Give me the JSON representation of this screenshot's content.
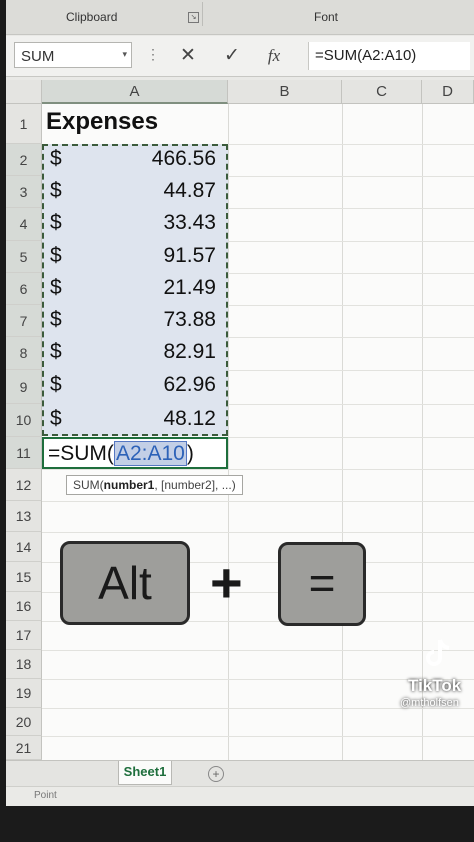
{
  "ribbon": {
    "clipboard_label": "Clipboard",
    "font_label": "Font"
  },
  "formula_bar": {
    "name_box": "SUM",
    "name_box_arrow": "▾",
    "dots": "⋮",
    "cancel_symbol": "✕",
    "enter_symbol": "✓",
    "fx_symbol": "fx",
    "formula": "=SUM(A2:A10)"
  },
  "columns": [
    "A",
    "B",
    "C",
    "D"
  ],
  "rows": [
    "1",
    "2",
    "3",
    "4",
    "5",
    "6",
    "7",
    "8",
    "9",
    "10",
    "11",
    "12",
    "13",
    "14",
    "15",
    "16",
    "17",
    "18",
    "19",
    "20",
    "21"
  ],
  "sheet": {
    "header": "Expenses",
    "currency_symbol": "$",
    "values": [
      "466.56",
      "44.87",
      "33.43",
      "91.57",
      "21.49",
      "73.88",
      "82.91",
      "62.96",
      "48.12"
    ],
    "active_cell": {
      "prefix": "=SUM(",
      "ref": "A2:A10",
      "suffix": ")"
    }
  },
  "tooltip": {
    "fn": "SUM(",
    "arg1": "number1",
    "rest": ", [number2], ...)"
  },
  "overlay": {
    "key1": "Alt",
    "plus": "+",
    "key2": "="
  },
  "watermark": {
    "brand": "TikTok",
    "handle": "@mtholfsen"
  },
  "tabs": {
    "sheet1": "Sheet1",
    "add": "+"
  },
  "status": {
    "mode": "Point"
  }
}
